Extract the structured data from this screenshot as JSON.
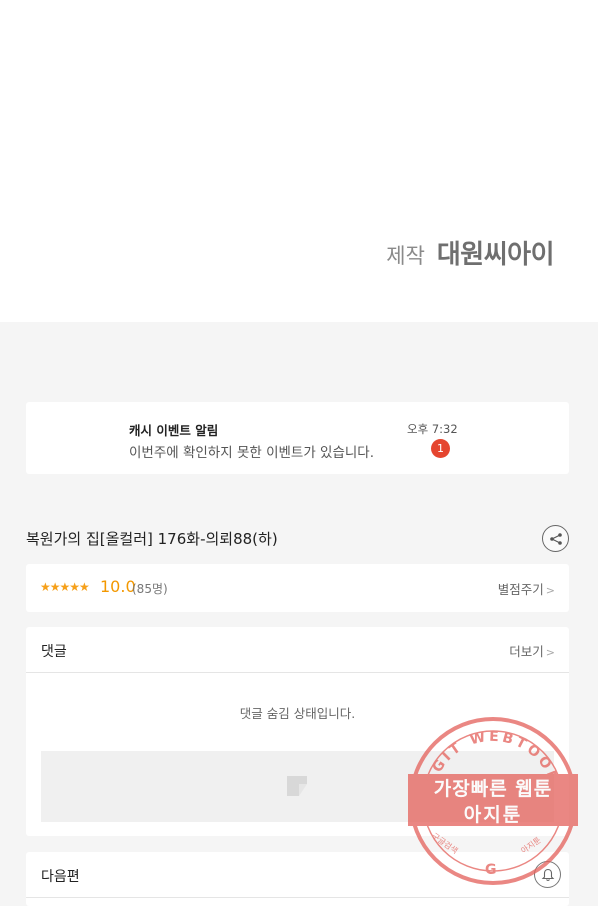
{
  "credit": {
    "label": "제작",
    "name": "대원씨아이"
  },
  "notice": {
    "title": "캐시 이벤트 알림",
    "message": "이번주에 확인하지 못한 이벤트가 있습니다.",
    "time": "오후 7:32",
    "badge": "1"
  },
  "episode": {
    "title": "복원가의 집[올컬러] 176화-의뢰88(하)"
  },
  "rating": {
    "stars": "★★★★★",
    "score": "10.0",
    "count": "(85명)",
    "action_label": "별점주기"
  },
  "comments": {
    "label": "댓글",
    "more_label": "더보기",
    "hidden_message": "댓글 숨김 상태입니다."
  },
  "next": {
    "label": "다음편"
  },
  "watermark": {
    "ring_text": "AGIT WEBTOON",
    "line1": "가장빠른 웹툰",
    "line2": "아지툰",
    "small_left": "구글검색",
    "small_right": "아지툰",
    "g_letter": "G"
  },
  "colors": {
    "accent_star": "#f39800",
    "badge": "#e5452f",
    "watermark": "#e4605a"
  }
}
